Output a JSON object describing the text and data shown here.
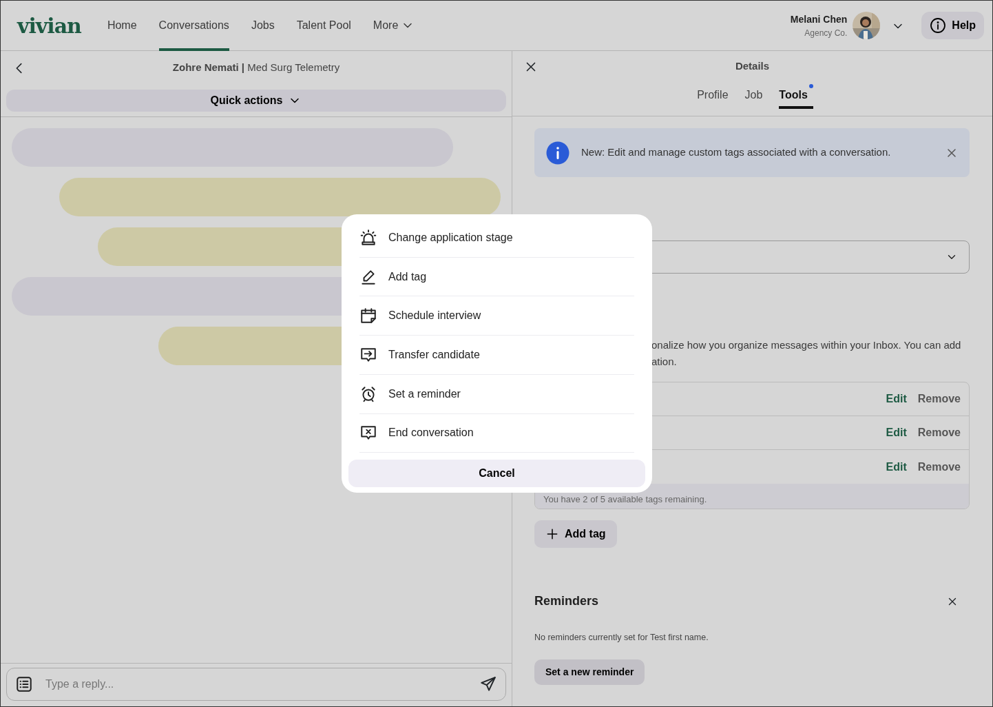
{
  "nav": {
    "logo": "vivian",
    "links": [
      {
        "label": "Home",
        "selected": false
      },
      {
        "label": "Conversations",
        "selected": true
      },
      {
        "label": "Jobs",
        "selected": false
      },
      {
        "label": "Talent Pool",
        "selected": false
      }
    ],
    "more": "More",
    "user": {
      "name": "Melani Chen",
      "org": "Agency Co."
    },
    "help": "Help"
  },
  "conversation": {
    "name": "Zohre Nemati",
    "separator": "|",
    "role": "Med Surg Telemetry",
    "quick_actions": "Quick actions",
    "messages": [
      {
        "kind": "received"
      },
      {
        "kind": "sent"
      },
      {
        "kind": "sent"
      },
      {
        "kind": "received"
      },
      {
        "kind": "sent"
      }
    ],
    "composer": {
      "placeholder": "Type a reply..."
    }
  },
  "details": {
    "title": "Details",
    "tabs": [
      {
        "label": "Profile",
        "selected": false,
        "dot": false
      },
      {
        "label": "Job",
        "selected": false,
        "dot": false
      },
      {
        "label": "Tools",
        "selected": true,
        "dot": true
      }
    ],
    "notice": "New: Edit and manage custom tags associated with a conversation.",
    "tags_description": [
      "onalize how you organize messages within your Inbox. You can add",
      "ation."
    ],
    "tag_rows": [
      {
        "edit": "Edit",
        "remove": "Remove"
      },
      {
        "edit": "Edit",
        "remove": "Remove"
      },
      {
        "edit": "Edit",
        "remove": "Remove"
      }
    ],
    "tags_footer": "You have 2 of 5 available tags remaining.",
    "add_tag": "Add tag",
    "reminders": {
      "title": "Reminders",
      "empty": "No reminders currently set for Test first name.",
      "button": "Set a new reminder"
    }
  },
  "quick_actions_menu": {
    "items": [
      {
        "kind": "stage",
        "label": "Change application stage"
      },
      {
        "kind": "tag",
        "label": "Add tag"
      },
      {
        "kind": "schedule",
        "label": "Schedule interview"
      },
      {
        "kind": "transfer",
        "label": "Transfer candidate"
      },
      {
        "kind": "reminder",
        "label": "Set a reminder"
      },
      {
        "kind": "end",
        "label": "End conversation"
      }
    ],
    "cancel": "Cancel"
  }
}
